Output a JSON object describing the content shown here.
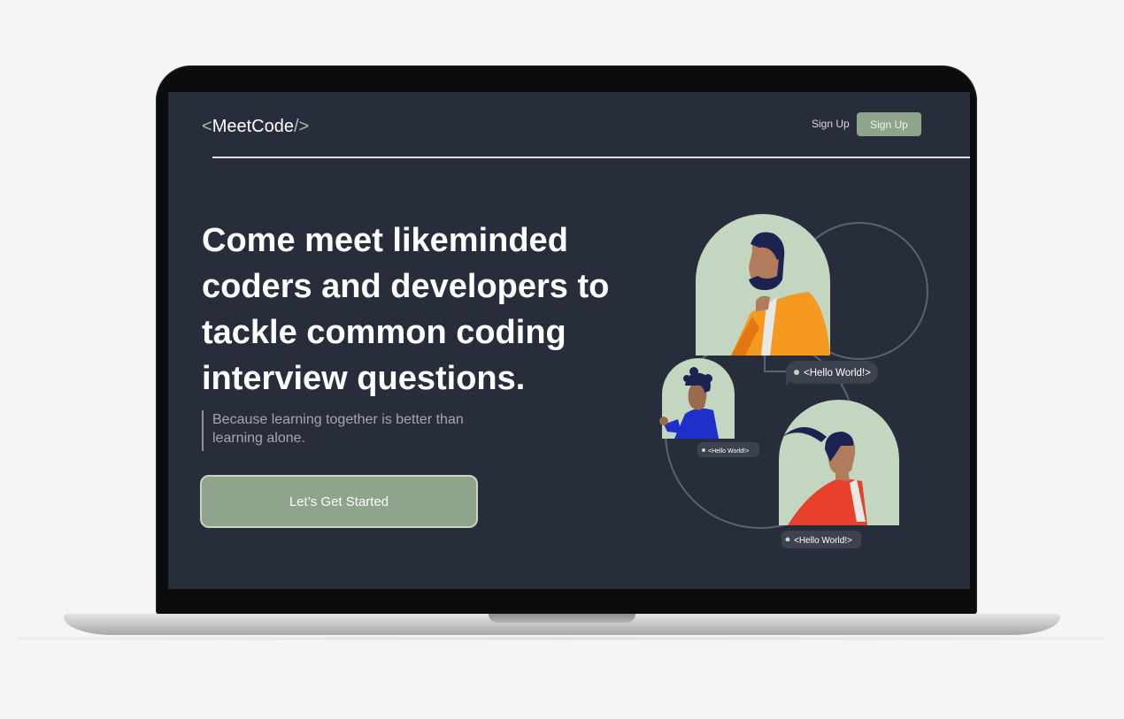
{
  "brand": {
    "open": "<",
    "name": "MeetCode",
    "close": "/>"
  },
  "nav": {
    "signup_link": "Sign Up",
    "signup_button": "Sign Up"
  },
  "hero": {
    "headline": "Come meet likeminded coders and developers to tackle common coding interview questions.",
    "subtext": "Because learning together is better than learning alone.",
    "cta_label": "Let’s Get Started"
  },
  "illustration": {
    "bubbles": [
      "<Hello World!>",
      "<Hello World!>",
      "<Hello World!>"
    ]
  },
  "colors": {
    "screen_bg": "#282d3b",
    "accent_sage": "#8ea48b",
    "avatar_bg": "#c2d6c0",
    "orange": "#f59a1f",
    "red": "#e8412b",
    "blue": "#1f2fc9",
    "navy_hair": "#1d2351"
  }
}
